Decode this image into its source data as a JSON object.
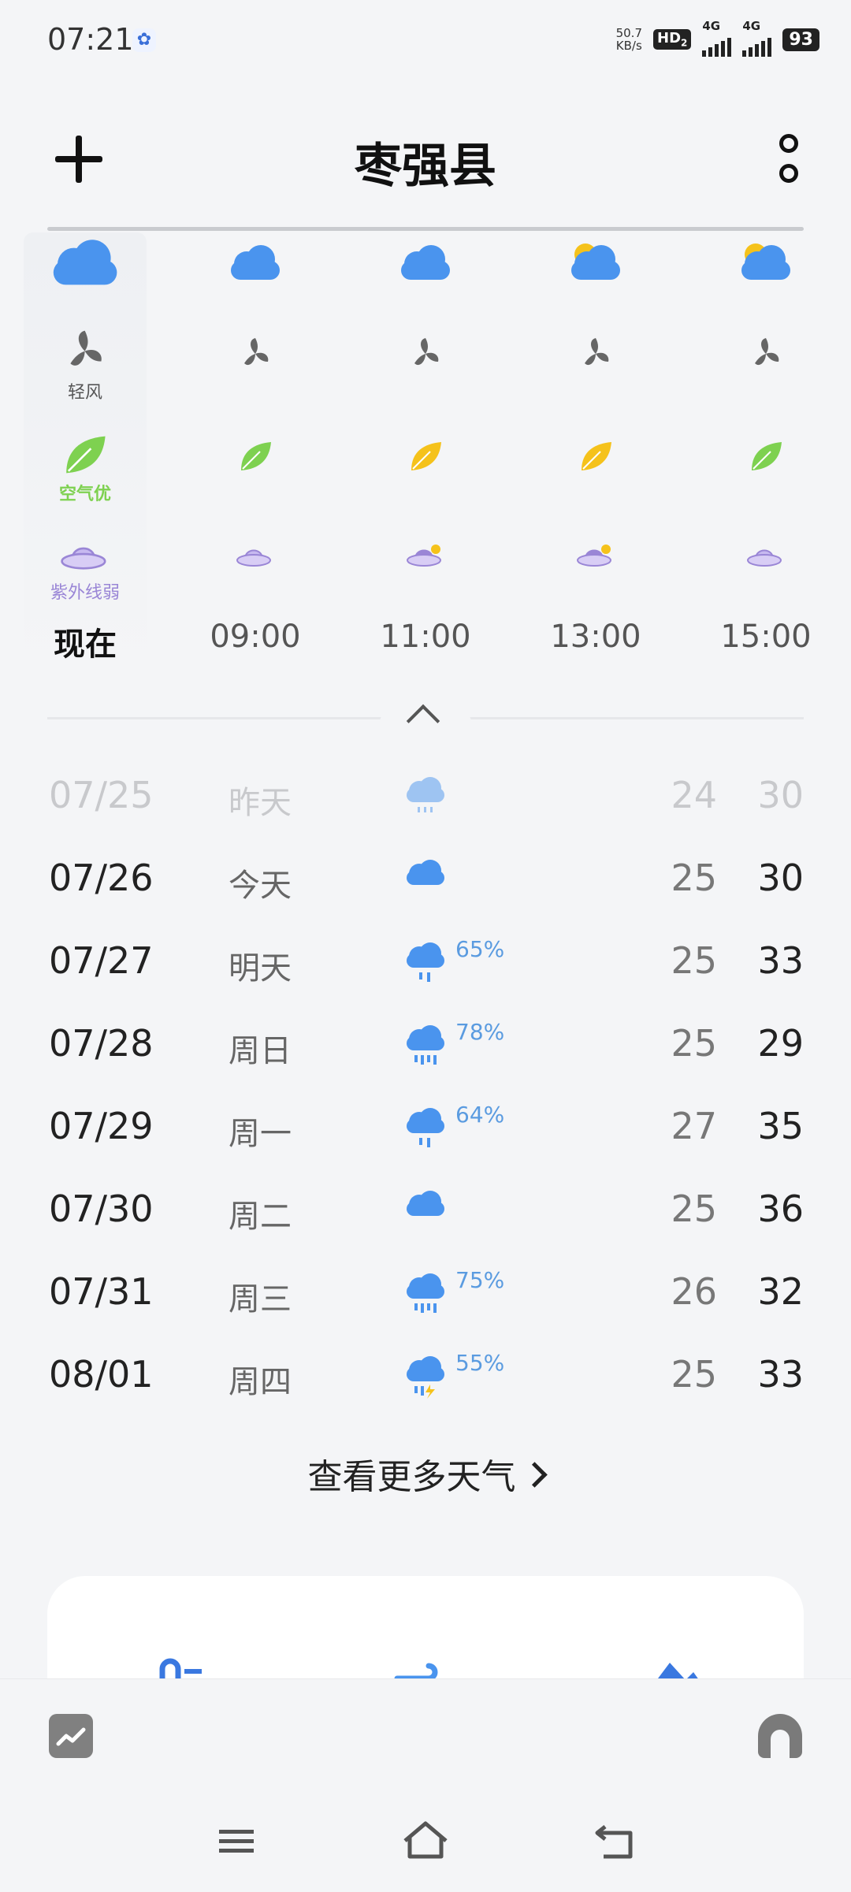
{
  "status_bar": {
    "time": "07:21",
    "net_speed_value": "50.7",
    "net_speed_unit": "KB/s",
    "hd_badge": "HD",
    "hd_sub": "2",
    "signal1_label": "4G",
    "signal2_label": "4G",
    "battery": "93"
  },
  "header": {
    "title": "枣强县"
  },
  "hourly": {
    "labels": {
      "wind": "轻风",
      "air": "空气优",
      "uv": "紫外线弱"
    },
    "columns": [
      {
        "time": "现在",
        "weather_icon": "cloudy-icon",
        "leaf_color": "#7ed150",
        "uv_sun": false
      },
      {
        "time": "09:00",
        "weather_icon": "cloudy-icon",
        "leaf_color": "#7ed150",
        "uv_sun": false
      },
      {
        "time": "11:00",
        "weather_icon": "cloudy-icon",
        "leaf_color": "#f5c21b",
        "uv_sun": true
      },
      {
        "time": "13:00",
        "weather_icon": "partly-cloudy-icon",
        "leaf_color": "#f5c21b",
        "uv_sun": true
      },
      {
        "time": "15:00",
        "weather_icon": "partly-cloudy-icon",
        "leaf_color": "#7ed150",
        "uv_sun": false
      }
    ]
  },
  "daily": [
    {
      "date": "07/25",
      "day": "昨天",
      "icon": "light-rain-icon",
      "pop": "",
      "low": "24",
      "high": "30",
      "past": true
    },
    {
      "date": "07/26",
      "day": "今天",
      "icon": "cloudy-icon",
      "pop": "",
      "low": "25",
      "high": "30",
      "past": false
    },
    {
      "date": "07/27",
      "day": "明天",
      "icon": "rain-icon",
      "pop": "65%",
      "low": "25",
      "high": "33",
      "past": false
    },
    {
      "date": "07/28",
      "day": "周日",
      "icon": "heavy-rain-icon",
      "pop": "78%",
      "low": "25",
      "high": "29",
      "past": false
    },
    {
      "date": "07/29",
      "day": "周一",
      "icon": "rain-icon",
      "pop": "64%",
      "low": "27",
      "high": "35",
      "past": false
    },
    {
      "date": "07/30",
      "day": "周二",
      "icon": "cloudy-icon",
      "pop": "",
      "low": "25",
      "high": "36",
      "past": false
    },
    {
      "date": "07/31",
      "day": "周三",
      "icon": "heavy-rain-icon",
      "pop": "75%",
      "low": "26",
      "high": "32",
      "past": false
    },
    {
      "date": "08/01",
      "day": "周四",
      "icon": "thunder-rain-icon",
      "pop": "55%",
      "low": "25",
      "high": "33",
      "past": false
    }
  ],
  "more_weather_label": "查看更多天气",
  "colors": {
    "cloud": "#4a94ee",
    "sun": "#f5c21b",
    "air_good": "#7ed150",
    "uv": "#9a86d6",
    "pop": "#5a9be0"
  }
}
